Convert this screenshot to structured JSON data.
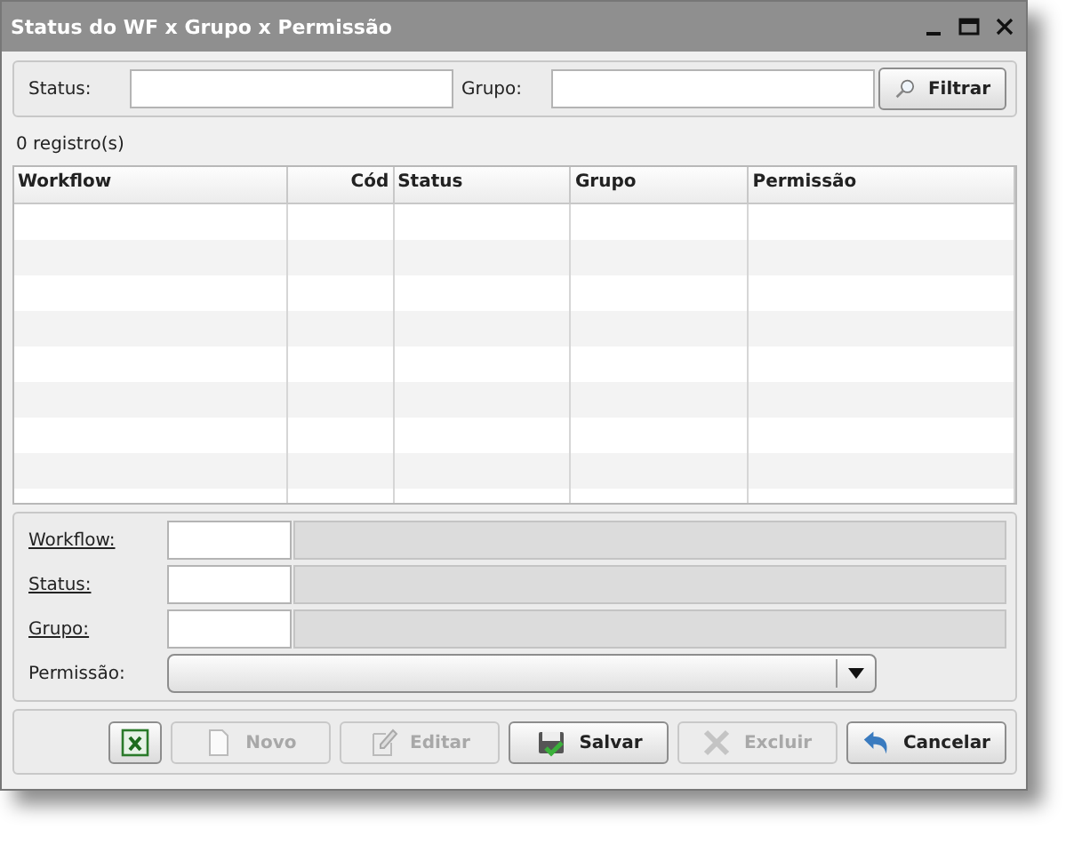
{
  "window": {
    "title": "Status do WF x Grupo x Permissão"
  },
  "filter": {
    "fields": [
      {
        "label": "Status:"
      },
      {
        "label": "Grupo:"
      }
    ],
    "button": "Filtrar"
  },
  "record_count": "0 registro(s)",
  "table": {
    "columns": [
      {
        "label": "Workflow",
        "right_aligned": false
      },
      {
        "label": "Cód",
        "right_aligned": true
      },
      {
        "label": "Status",
        "right_aligned": false
      },
      {
        "label": "Grupo",
        "right_aligned": false
      },
      {
        "label": "Permissão",
        "right_aligned": false
      }
    ]
  },
  "form": {
    "lookups": [
      {
        "label": "Workflow:",
        "underlined": true
      },
      {
        "label": "Status:",
        "underlined": true
      },
      {
        "label": "Grupo:",
        "underlined": true
      }
    ],
    "permission": {
      "label": "Permissão:",
      "underlined": false
    }
  },
  "buttons": [
    {
      "kind": "excel",
      "disabled": false
    },
    {
      "kind": "new",
      "label": "Novo",
      "disabled": true
    },
    {
      "kind": "edit",
      "label": "Editar",
      "disabled": true
    },
    {
      "kind": "save",
      "label": "Salvar",
      "disabled": false
    },
    {
      "kind": "delete",
      "label": "Excluir",
      "disabled": true
    },
    {
      "kind": "cancel",
      "label": "Cancelar",
      "disabled": false
    }
  ]
}
